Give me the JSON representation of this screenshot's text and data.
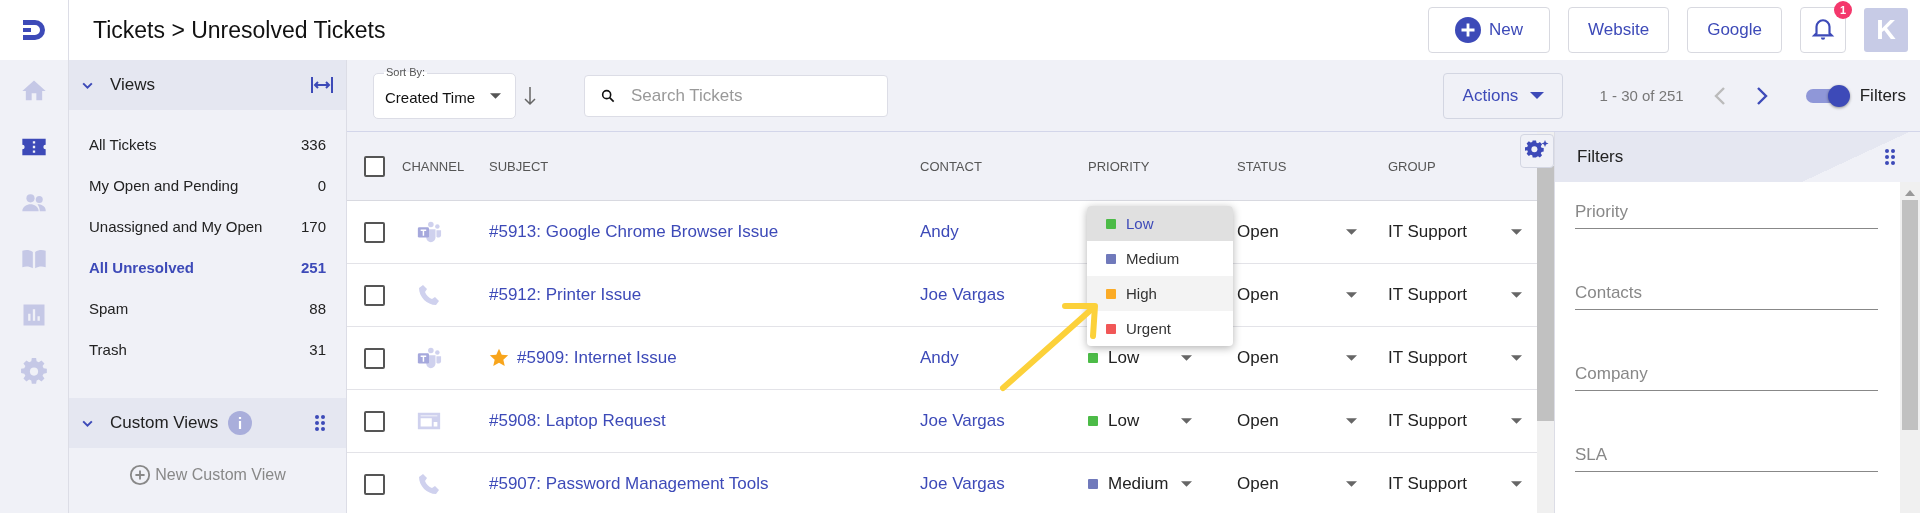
{
  "nav": [
    {
      "kind": "home",
      "selected": false
    },
    {
      "kind": "tickets",
      "selected": true
    },
    {
      "kind": "contacts",
      "selected": false
    },
    {
      "kind": "knowledge",
      "selected": false
    },
    {
      "kind": "reports",
      "selected": false
    },
    {
      "kind": "settings",
      "selected": false
    }
  ],
  "header": {
    "title": "Tickets > Unresolved Tickets",
    "buttons": [
      {
        "kind": "new",
        "label": "New"
      },
      {
        "kind": "plain",
        "label": "Website"
      },
      {
        "kind": "plain",
        "label": "Google"
      }
    ],
    "notifications": "1",
    "avatar": "K"
  },
  "views": {
    "title": "Views",
    "expanded": true,
    "items": [
      {
        "label": "All Tickets",
        "count": "336",
        "selected": false
      },
      {
        "label": "My Open and Pending",
        "count": "0",
        "selected": false
      },
      {
        "label": "Unassigned and My Open",
        "count": "170",
        "selected": false
      },
      {
        "label": "All Unresolved",
        "count": "251",
        "selected": true
      },
      {
        "label": "Spam",
        "count": "88",
        "selected": false
      },
      {
        "label": "Trash",
        "count": "31",
        "selected": false
      }
    ]
  },
  "custom_views": {
    "title": "Custom Views",
    "expanded": true,
    "new_label": "New Custom View"
  },
  "toolbar": {
    "sort_label": "Sort By:",
    "sort_value": "Created Time",
    "search_placeholder": "Search Tickets",
    "actions": "Actions",
    "range": "1 - 30 of 251",
    "prev_disabled": true,
    "next_disabled": false,
    "filters_on": true,
    "filters_label": "Filters"
  },
  "table": {
    "columns": [
      "CHANNEL",
      "SUBJECT",
      "CONTACT",
      "PRIORITY",
      "STATUS",
      "GROUP"
    ],
    "all_checked": false,
    "rows": [
      {
        "checked": false,
        "kind": "teams",
        "starred": false,
        "subject": "#5913: Google Chrome Browser Issue",
        "contact": "Andy",
        "status": "Open",
        "group": "IT Support"
      },
      {
        "checked": false,
        "kind": "phone",
        "starred": false,
        "subject": "#5912: Printer Issue",
        "contact": "Joe Vargas",
        "status": "Open",
        "group": "IT Support"
      },
      {
        "checked": false,
        "kind": "teams",
        "starred": true,
        "subject": "#5909: Internet Issue",
        "contact": "Andy",
        "priority": {
          "label": "Low",
          "color": "#4cbb47"
        },
        "status": "Open",
        "group": "IT Support"
      },
      {
        "checked": false,
        "kind": "form",
        "starred": false,
        "subject": "#5908: Laptop Request",
        "contact": "Joe Vargas",
        "priority": {
          "label": "Low",
          "color": "#4cbb47"
        },
        "status": "Open",
        "group": "IT Support"
      },
      {
        "checked": false,
        "kind": "phone",
        "starred": false,
        "subject": "#5907: Password Management Tools",
        "contact": "Joe Vargas",
        "priority": {
          "label": "Medium",
          "color": "#7079bb"
        },
        "status": "Open",
        "group": "IT Support"
      }
    ]
  },
  "priority_menu": {
    "options": [
      {
        "label": "Low",
        "color": "#4cbb47",
        "selected": true,
        "hovered": false
      },
      {
        "label": "Medium",
        "color": "#7079bb",
        "selected": false,
        "hovered": false
      },
      {
        "label": "High",
        "color": "#fbab26",
        "selected": false,
        "hovered": true
      },
      {
        "label": "Urgent",
        "color": "#f15757",
        "selected": false,
        "hovered": false
      }
    ]
  },
  "filters": {
    "title": "Filters",
    "fields": [
      {
        "placeholder": "Priority"
      },
      {
        "placeholder": "Contacts"
      },
      {
        "placeholder": "Company"
      },
      {
        "placeholder": "SLA"
      }
    ]
  }
}
